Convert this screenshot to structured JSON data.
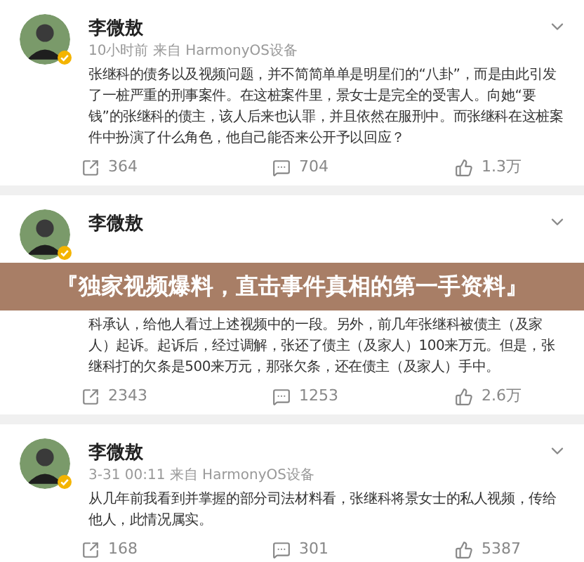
{
  "posts": [
    {
      "author": "李微敖",
      "meta": "10小时前 来自 HarmonyOS设备",
      "body": "张继科的债务以及视频问题，并不简简单单是明星们的“八卦”，而是由此引发了一桩严重的刑事案件。在这桩案件里，景女士是完全的受害人。向她“要钱”的张继科的债主，该人后来也认罪，并且依然在服刑中。而张继科在这桩案件中扮演了什么角色，他自己能否来公开予以回应？",
      "reposts": "364",
      "comments": "704",
      "likes": "1.3万"
    },
    {
      "author": "李微敖",
      "banner": "『独家视频爆料，直击事件真相的第一手资料』",
      "body": "科承认，给他人看过上述视频中的一段。另外，前几年张继科被债主（及家人）起诉。起诉后，经过调解，张还了债主（及家人）100来万元。但是，张继科打的欠条是500来万元，那张欠条，还在债主（及家人）手中。",
      "reposts": "2343",
      "comments": "1253",
      "likes": "2.6万"
    },
    {
      "author": "李微敖",
      "meta": "3-31 00:11 来自 HarmonyOS设备",
      "body": "从几年前我看到并掌握的部分司法材料看，张继科将景女士的私人视频，传给他人，此情况属实。",
      "reposts": "168",
      "comments": "301",
      "likes": "5387"
    }
  ]
}
